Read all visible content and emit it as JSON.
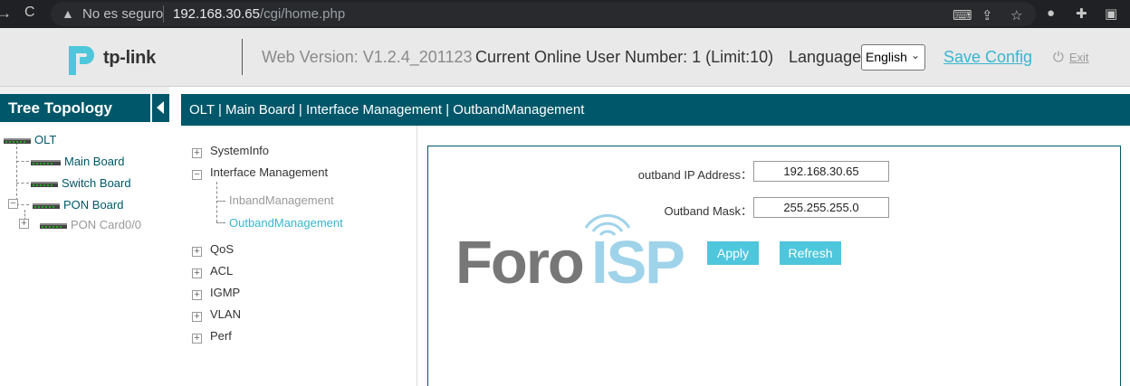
{
  "browser": {
    "security_label": "No es seguro",
    "url_host": "192.168.30.65",
    "url_path": "/cgi/home.php"
  },
  "header": {
    "logo_text": "tp-link",
    "web_version": "Web Version: V1.2.4_201123",
    "online_users": "Current Online User Number: 1 (Limit:10)",
    "language_label": "Language",
    "language_value": "English",
    "save_config": "Save Config",
    "exit": "Exit"
  },
  "tree": {
    "title": "Tree Topology",
    "nodes": {
      "olt": "OLT",
      "main_board": "Main Board",
      "switch_board": "Switch Board",
      "pon_board": "PON Board",
      "pon_card": "PON Card0/0"
    }
  },
  "breadcrumb": "OLT | Main Board | Interface Management | OutbandManagement",
  "menu": {
    "items": {
      "systeminfo": "SystemInfo",
      "interface_management": "Interface Management",
      "inband": "InbandManagement",
      "outband": "OutbandManagement",
      "qos": "QoS",
      "acl": "ACL",
      "igmp": "IGMP",
      "vlan": "VLAN",
      "perf": "Perf"
    }
  },
  "form": {
    "ip_label": "outband IP Address：",
    "ip_value": "192.168.30.65",
    "mask_label": "Outband Mask：",
    "mask_value": "255.255.255.0",
    "apply": "Apply",
    "refresh": "Refresh"
  },
  "watermark": {
    "text_a": "Foro",
    "text_b": "ISP"
  },
  "colors": {
    "primary": "#00576a",
    "accent": "#38b6d0",
    "button": "#4ec6dc",
    "topbar": "#e9e9e9"
  }
}
